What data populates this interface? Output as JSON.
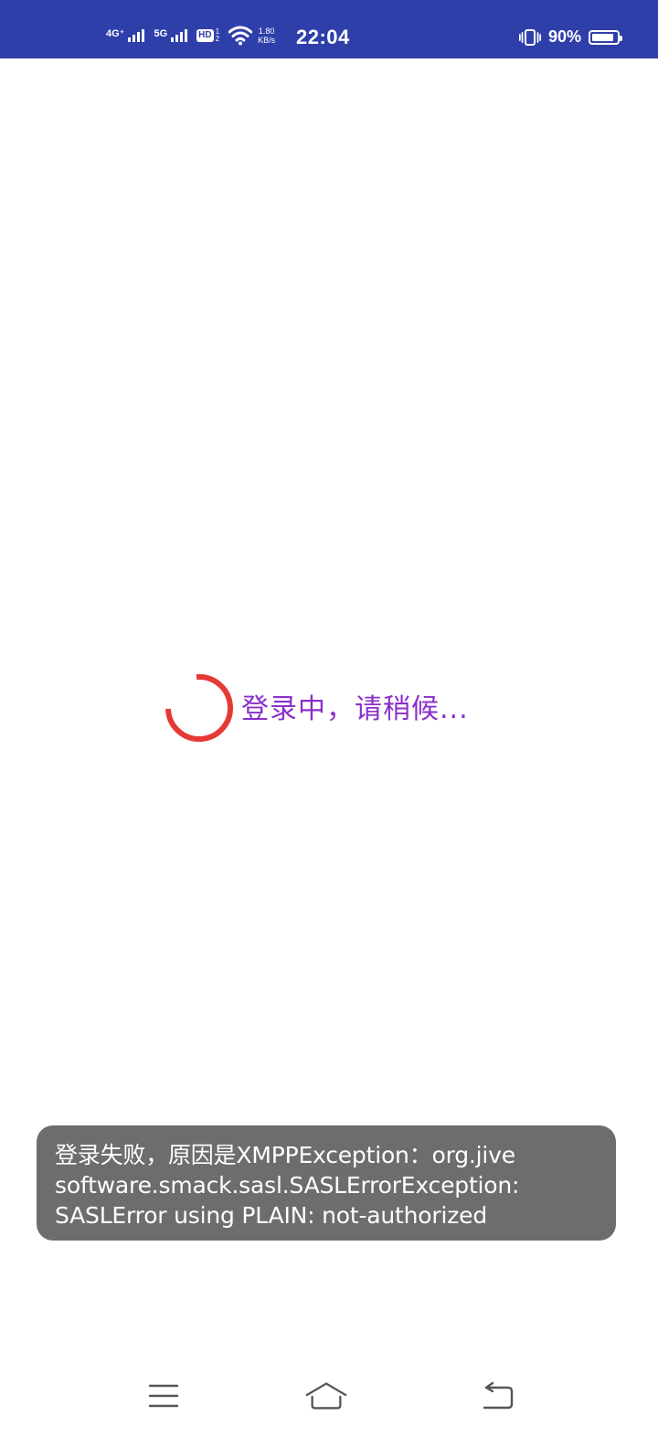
{
  "status_bar": {
    "signal1_label": "4G⁺",
    "signal2_label": "5G",
    "hd_label": "HD",
    "hd_sub_top": "1",
    "hd_sub_bottom": "2",
    "net_speed_value": "1.80",
    "net_speed_unit": "KB/s",
    "time": "22:04",
    "battery_percent": "90%",
    "battery_level": 0.9,
    "icons": [
      "signal-bars-icon",
      "hd-icon",
      "wifi-icon",
      "vibrate-icon",
      "battery-icon"
    ]
  },
  "loading": {
    "text": "登录中，请稍候...",
    "spinner_color": "#e53935",
    "text_color": "#8b2fc9"
  },
  "toast": {
    "lines": [
      "登录失败，原因是XMPPException：org.jive",
      "software.smack.sasl.SASLErrorException:",
      "SASLError using PLAIN: not-authorized"
    ]
  },
  "nav_bar": {
    "icons": [
      "menu-icon",
      "home-icon",
      "back-icon"
    ]
  },
  "colors": {
    "status_bar_bg": "#2f3faa",
    "toast_bg": "#6d6d6d"
  }
}
